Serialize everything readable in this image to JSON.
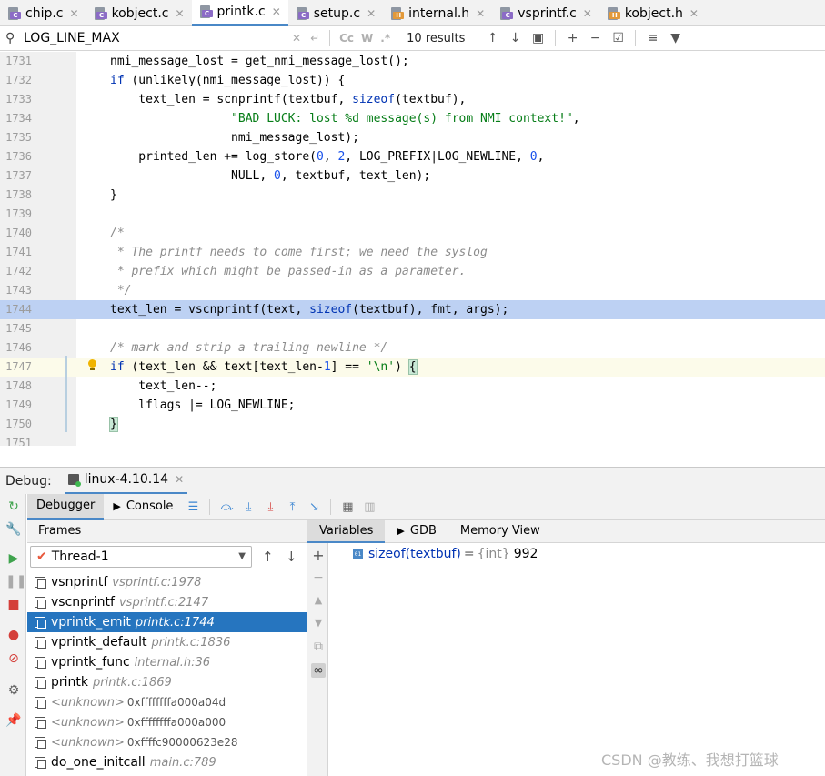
{
  "tabs": [
    {
      "name": "chip.c",
      "type": "c",
      "active": false
    },
    {
      "name": "kobject.c",
      "type": "c",
      "active": false
    },
    {
      "name": "printk.c",
      "type": "c",
      "active": true
    },
    {
      "name": "setup.c",
      "type": "c",
      "active": false
    },
    {
      "name": "internal.h",
      "type": "h",
      "active": false
    },
    {
      "name": "vsprintf.c",
      "type": "c",
      "active": false
    },
    {
      "name": "kobject.h",
      "type": "h",
      "active": false
    }
  ],
  "search": {
    "query": "LOG_LINE_MAX",
    "results": "10 results",
    "opt_case": "Cc",
    "opt_word": "W",
    "opt_regex": ".*"
  },
  "code": {
    "highlight_line": "1744",
    "current_line": "1747",
    "lines": [
      {
        "no": "1731",
        "text": "nmi_message_lost = get_nmi_message_lost();"
      },
      {
        "no": "1732",
        "text": "if (unlikely(nmi_message_lost)) {"
      },
      {
        "no": "1733",
        "text": "    text_len = scnprintf(textbuf, sizeof(textbuf),"
      },
      {
        "no": "1734",
        "text": "                 \"BAD LUCK: lost %d message(s) from NMI context!\","
      },
      {
        "no": "1735",
        "text": "                 nmi_message_lost);"
      },
      {
        "no": "1736",
        "text": "    printed_len += log_store(0, 2, LOG_PREFIX|LOG_NEWLINE, 0,"
      },
      {
        "no": "1737",
        "text": "                 NULL, 0, textbuf, text_len);"
      },
      {
        "no": "1738",
        "text": "}"
      },
      {
        "no": "1739",
        "text": ""
      },
      {
        "no": "1740",
        "text": "/*"
      },
      {
        "no": "1741",
        "text": " * The printf needs to come first; we need the syslog"
      },
      {
        "no": "1742",
        "text": " * prefix which might be passed-in as a parameter."
      },
      {
        "no": "1743",
        "text": " */"
      },
      {
        "no": "1744",
        "text": "text_len = vscnprintf(text, sizeof(textbuf), fmt, args);"
      },
      {
        "no": "1745",
        "text": ""
      },
      {
        "no": "1746",
        "text": "/* mark and strip a trailing newline */"
      },
      {
        "no": "1747",
        "text": "if (text_len && text[text_len-1] == '\\n') {"
      },
      {
        "no": "1748",
        "text": "    text_len--;"
      },
      {
        "no": "1749",
        "text": "    lflags |= LOG_NEWLINE;"
      },
      {
        "no": "1750",
        "text": "}"
      },
      {
        "no": "1751",
        "text": ""
      }
    ]
  },
  "debug": {
    "label": "Debug:",
    "session": "linux-4.10.14",
    "tabs": {
      "debugger": "Debugger",
      "console": "Console"
    },
    "frames_title": "Frames",
    "thread": "Thread-1",
    "frames": [
      {
        "func": "vsnprintf",
        "loc": "vsprintf.c:1978",
        "selected": false
      },
      {
        "func": "vscnprintf",
        "loc": "vsprintf.c:2147",
        "selected": false
      },
      {
        "func": "vprintk_emit",
        "loc": "printk.c:1744",
        "selected": true
      },
      {
        "func": "vprintk_default",
        "loc": "printk.c:1836",
        "selected": false
      },
      {
        "func": "vprintk_func",
        "loc": "internal.h:36",
        "selected": false
      },
      {
        "func": "printk",
        "loc": "printk.c:1869",
        "selected": false
      },
      {
        "func": "<unknown>",
        "loc": "0xffffffffa000a04d",
        "selected": false,
        "unknown": true
      },
      {
        "func": "<unknown>",
        "loc": "0xffffffffa000a000",
        "selected": false,
        "unknown": true
      },
      {
        "func": "<unknown>",
        "loc": "0xffffc90000623e28",
        "selected": false,
        "unknown": true
      },
      {
        "func": "do_one_initcall",
        "loc": "main.c:789",
        "selected": false
      }
    ],
    "var_tabs": {
      "variables": "Variables",
      "gdb": "GDB",
      "memory": "Memory View"
    },
    "variable": {
      "name": "sizeof(textbuf)",
      "eq": "=",
      "type": "{int}",
      "value": "992",
      "icon": "01"
    }
  },
  "watermark": "CSDN @教练、我想打篮球",
  "colors": {
    "accent": "#4a88c7",
    "selection": "#2675bf",
    "highlight": "#bdd1f3",
    "keyword": "#0033b3",
    "string": "#067d17",
    "number": "#1750eb",
    "comment": "#8c8c8c"
  }
}
